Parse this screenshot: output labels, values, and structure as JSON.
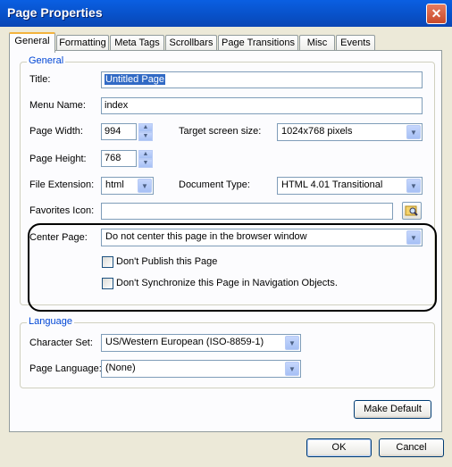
{
  "window": {
    "title": "Page Properties"
  },
  "tabs": [
    "General",
    "Formatting",
    "Meta Tags",
    "Scrollbars",
    "Page Transitions",
    "Misc",
    "Events"
  ],
  "general": {
    "group_label": "General",
    "title_label": "Title:",
    "title_value": "Untitled Page",
    "menu_label": "Menu Name:",
    "menu_value": "index",
    "width_label": "Page Width:",
    "width_value": "994",
    "target_label": "Target screen size:",
    "target_value": "1024x768 pixels",
    "height_label": "Page Height:",
    "height_value": "768",
    "ext_label": "File Extension:",
    "ext_value": "html",
    "doctype_label": "Document Type:",
    "doctype_value": "HTML 4.01 Transitional",
    "favicon_label": "Favorites Icon:",
    "favicon_value": "",
    "center_label": "Center Page:",
    "center_value": "Do not center this page in the browser window",
    "publish_label": "Don't Publish this Page",
    "publish_checked": false,
    "sync_label": "Don't Synchronize this Page in Navigation Objects.",
    "sync_checked": false
  },
  "language": {
    "group_label": "Language",
    "charset_label": "Character Set:",
    "charset_value": "US/Western European (ISO-8859-1)",
    "pagelang_label": "Page Language:",
    "pagelang_value": "(None)"
  },
  "buttons": {
    "make_default": "Make Default",
    "ok": "OK",
    "cancel": "Cancel"
  }
}
